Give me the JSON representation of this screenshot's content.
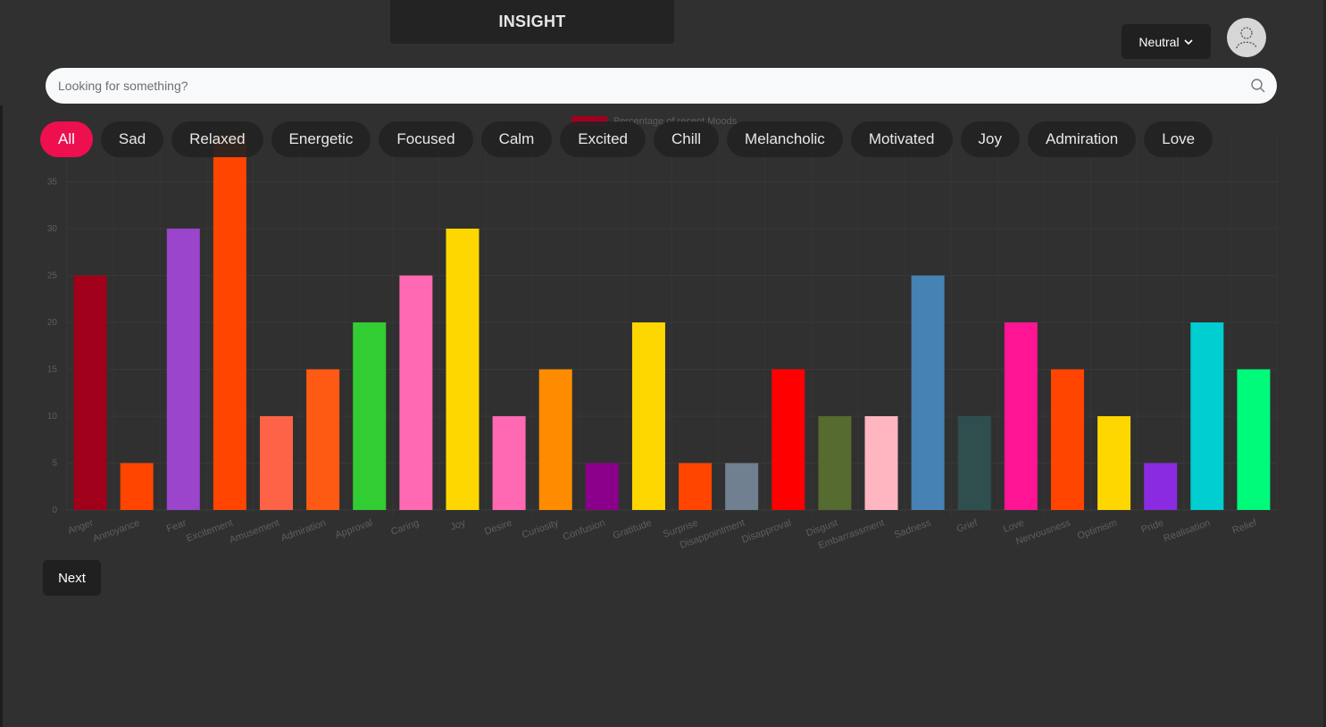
{
  "app": {
    "title": "INSIGHT"
  },
  "header": {
    "mood_selector": {
      "value": "Neutral",
      "icon": "chevron-down-icon"
    },
    "avatar": {
      "icon": "user-icon"
    }
  },
  "search": {
    "placeholder": "Looking for something?",
    "value": "",
    "icon": "search-icon"
  },
  "filters": {
    "items": [
      "All",
      "Sad",
      "Relaxed",
      "Energetic",
      "Focused",
      "Calm",
      "Excited",
      "Chill",
      "Melancholic",
      "Motivated",
      "Joy",
      "Admiration",
      "Love"
    ],
    "active": "All",
    "accent": "#ee0f4f"
  },
  "chart_data": {
    "type": "bar",
    "legend": "Percentage of recent Moods",
    "legend_color": "#a00020",
    "ylim": [
      0,
      40
    ],
    "yticks": [
      0,
      5,
      10,
      15,
      20,
      25,
      30,
      35
    ],
    "grid": true,
    "categories": [
      "Anger",
      "Annoyance",
      "Fear",
      "Excitement",
      "Amusement",
      "Admiration",
      "Approval",
      "Caring",
      "Joy",
      "Desire",
      "Curiosity",
      "Confusion",
      "Gratitude",
      "Surprise",
      "Disappointment",
      "Disapproval",
      "Disgust",
      "Embarrassment",
      "Sadness",
      "Grief",
      "Love",
      "Nervousness",
      "Optimism",
      "Pride",
      "Realisation",
      "Relief"
    ],
    "values": [
      25,
      5,
      30,
      40,
      10,
      15,
      20,
      25,
      30,
      10,
      15,
      5,
      20,
      5,
      5,
      15,
      10,
      10,
      25,
      10,
      20,
      15,
      10,
      5,
      20,
      15
    ],
    "colors": [
      "#a0001a",
      "#ff4500",
      "#9b44cc",
      "#ff4500",
      "#ff6347",
      "#ff5a14",
      "#32cd32",
      "#ff69b4",
      "#ffd700",
      "#ff69b4",
      "#ff8c00",
      "#8b008b",
      "#ffd700",
      "#ff4500",
      "#708090",
      "#ff0000",
      "#556b2f",
      "#ffb6c1",
      "#4682b4",
      "#2f4f4f",
      "#ff1493",
      "#ff4500",
      "#ffd700",
      "#8a2be2",
      "#00ced1",
      "#00fa7a"
    ]
  },
  "footer": {
    "next_label": "Next"
  }
}
